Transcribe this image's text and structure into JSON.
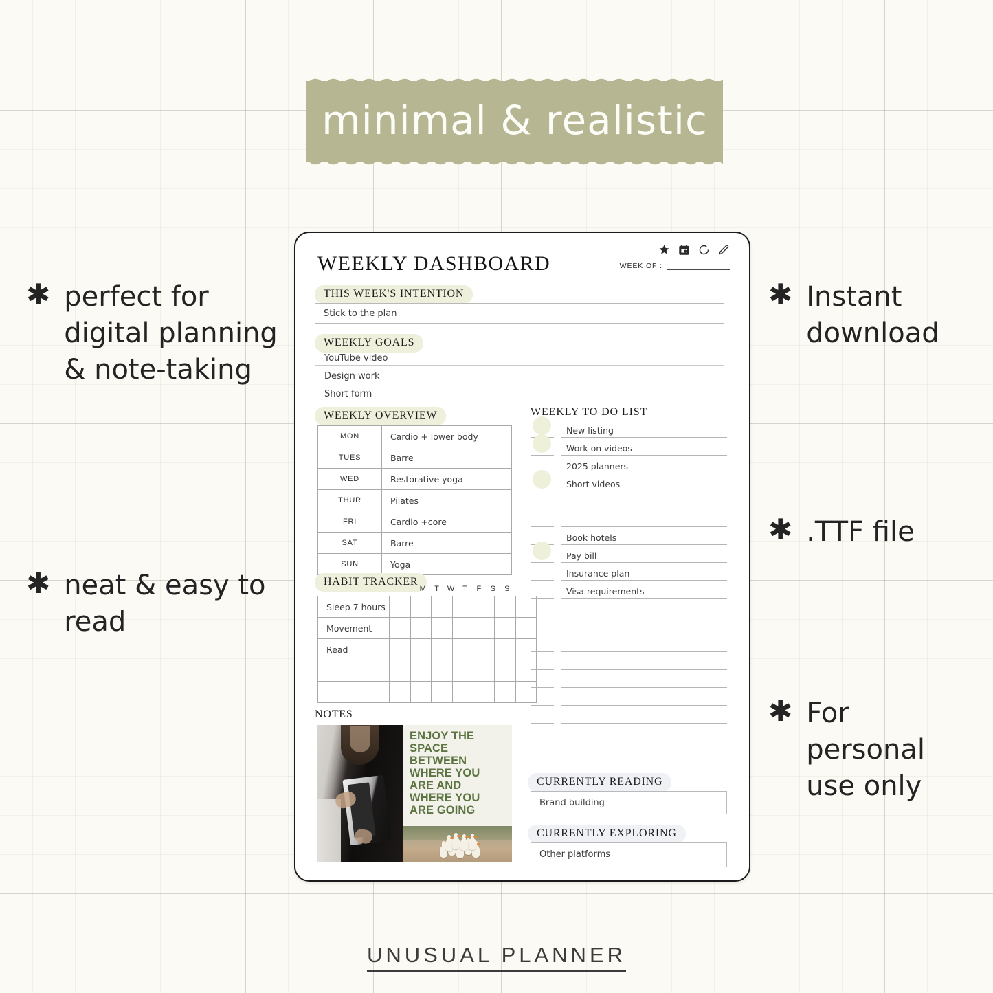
{
  "banner": {
    "text": "minimal & realistic",
    "bg_color": "#b6b693"
  },
  "features": [
    {
      "icon": "asterisk-icon",
      "text": "perfect for\ndigital planning\n& note-taking"
    },
    {
      "icon": "asterisk-icon",
      "text": "neat & easy to\nread"
    },
    {
      "icon": "asterisk-icon",
      "text": "Instant\ndownload"
    },
    {
      "icon": "asterisk-icon",
      "text": ".TTF file"
    },
    {
      "icon": "asterisk-icon",
      "text": "For\npersonal\nuse only"
    }
  ],
  "planner": {
    "title": "WEEKLY DASHBOARD",
    "week_of_label": "WEEK OF :",
    "toolbar_icons": [
      "star-icon",
      "calendar-icon",
      "circle-icon",
      "pencil-icon"
    ],
    "intention": {
      "heading": "THIS WEEK'S INTENTION",
      "value": "Stick to the plan"
    },
    "goals": {
      "heading": "WEEKLY GOALS",
      "items": [
        "YouTube video",
        "Design work",
        "Short form"
      ]
    },
    "overview": {
      "heading": "WEEKLY OVERVIEW",
      "rows": [
        {
          "day": "MON",
          "activity": "Cardio + lower body"
        },
        {
          "day": "TUES",
          "activity": "Barre"
        },
        {
          "day": "WED",
          "activity": "Restorative yoga"
        },
        {
          "day": "THUR",
          "activity": "Pilates"
        },
        {
          "day": "FRI",
          "activity": "Cardio +core"
        },
        {
          "day": "SAT",
          "activity": "Barre"
        },
        {
          "day": "SUN",
          "activity": "Yoga"
        }
      ]
    },
    "habit_tracker": {
      "heading": "HABIT TRACKER",
      "days": [
        "M",
        "T",
        "W",
        "T",
        "F",
        "S",
        "S"
      ],
      "habits": [
        "Sleep 7 hours",
        "Movement",
        "Read",
        "",
        ""
      ]
    },
    "notes": {
      "heading": "NOTES",
      "quote": "ENJOY THE SPACE BETWEEN WHERE YOU ARE AND WHERE YOU ARE GOING",
      "quote_color": "#5c7342"
    },
    "todo": {
      "heading": "WEEKLY TO DO LIST",
      "items": [
        {
          "text": "New listing",
          "checked": true
        },
        {
          "text": "Work on videos",
          "checked": true
        },
        {
          "text": "2025 planners",
          "checked": false
        },
        {
          "text": "Short videos",
          "checked": true
        },
        {
          "text": "",
          "checked": false
        },
        {
          "text": "",
          "checked": false
        },
        {
          "text": "Book hotels",
          "checked": false
        },
        {
          "text": "Pay bill",
          "checked": true
        },
        {
          "text": "Insurance plan",
          "checked": false
        },
        {
          "text": "Visa requirements",
          "checked": false
        },
        {
          "text": "",
          "checked": false
        },
        {
          "text": "",
          "checked": false
        },
        {
          "text": "",
          "checked": false
        },
        {
          "text": "",
          "checked": false
        },
        {
          "text": "",
          "checked": false
        },
        {
          "text": "",
          "checked": false
        },
        {
          "text": "",
          "checked": false
        },
        {
          "text": "",
          "checked": false
        },
        {
          "text": "",
          "checked": false
        }
      ]
    },
    "currently_reading": {
      "heading": "CURRENTLY READING",
      "value": "Brand building"
    },
    "currently_exploring": {
      "heading": "CURRENTLY EXPLORING",
      "value": "Other platforms"
    }
  },
  "footer": {
    "text": "UNUSUAL  PLANNER"
  }
}
